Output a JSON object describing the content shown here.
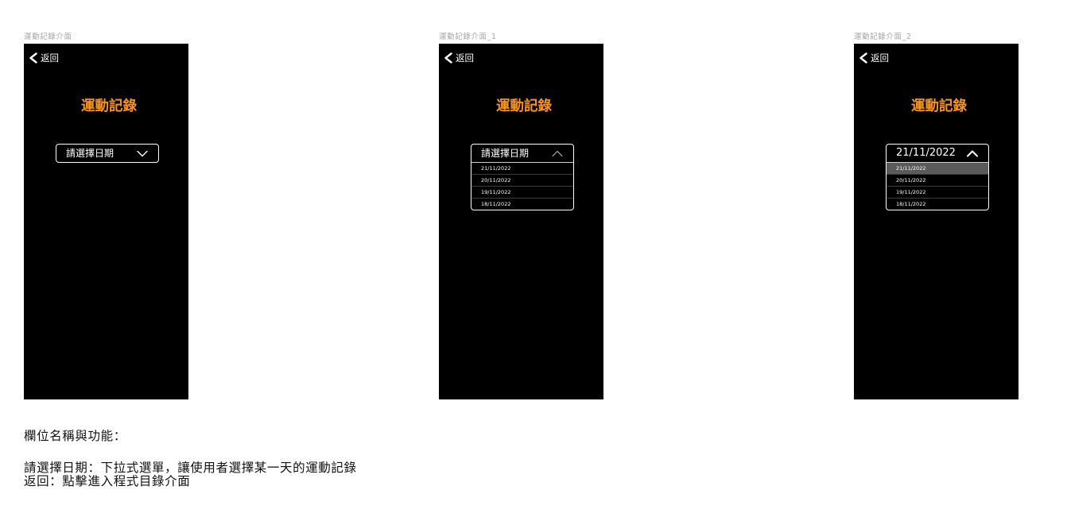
{
  "colors": {
    "page_background": "#ffffff",
    "screen_background": "#000000",
    "accent": "#f7931e",
    "text_primary": "#ffffff",
    "frame_label": "#a6a6a6",
    "option_highlight": "#5a5a5a",
    "option_divider": "#3c3c3c",
    "notes_text": "#111111"
  },
  "screens": [
    {
      "frame_label": "運動記錄介面",
      "back": {
        "label": "返回",
        "icon": "chevron-left-icon"
      },
      "title": "運動記錄",
      "dropdown": {
        "value": "請選擇日期",
        "expanded": false,
        "icon": "chevron-down-icon",
        "options": []
      }
    },
    {
      "frame_label": "運動記錄介面_1",
      "back": {
        "label": "返回",
        "icon": "chevron-left-icon"
      },
      "title": "運動記錄",
      "dropdown": {
        "value": "請選擇日期",
        "expanded": true,
        "icon": "chevron-up-icon",
        "options": [
          "21/11/2022",
          "20/11/2022",
          "19/11/2022",
          "18/11/2022"
        ]
      }
    },
    {
      "frame_label": "運動記錄介面_2",
      "back": {
        "label": "返回",
        "icon": "chevron-left-icon"
      },
      "title": "運動記錄",
      "dropdown": {
        "value": "21/11/2022",
        "expanded": true,
        "icon": "chevron-up-icon",
        "highlighted_index": 0,
        "options": [
          "21/11/2022",
          "20/11/2022",
          "19/11/2022",
          "18/11/2022"
        ]
      }
    }
  ],
  "notes": {
    "heading": "欄位名稱與功能：",
    "lines": [
      "請選擇日期：下拉式選單，讓使用者選擇某一天的運動記錄",
      "返回：點擊進入程式目錄介面"
    ]
  }
}
